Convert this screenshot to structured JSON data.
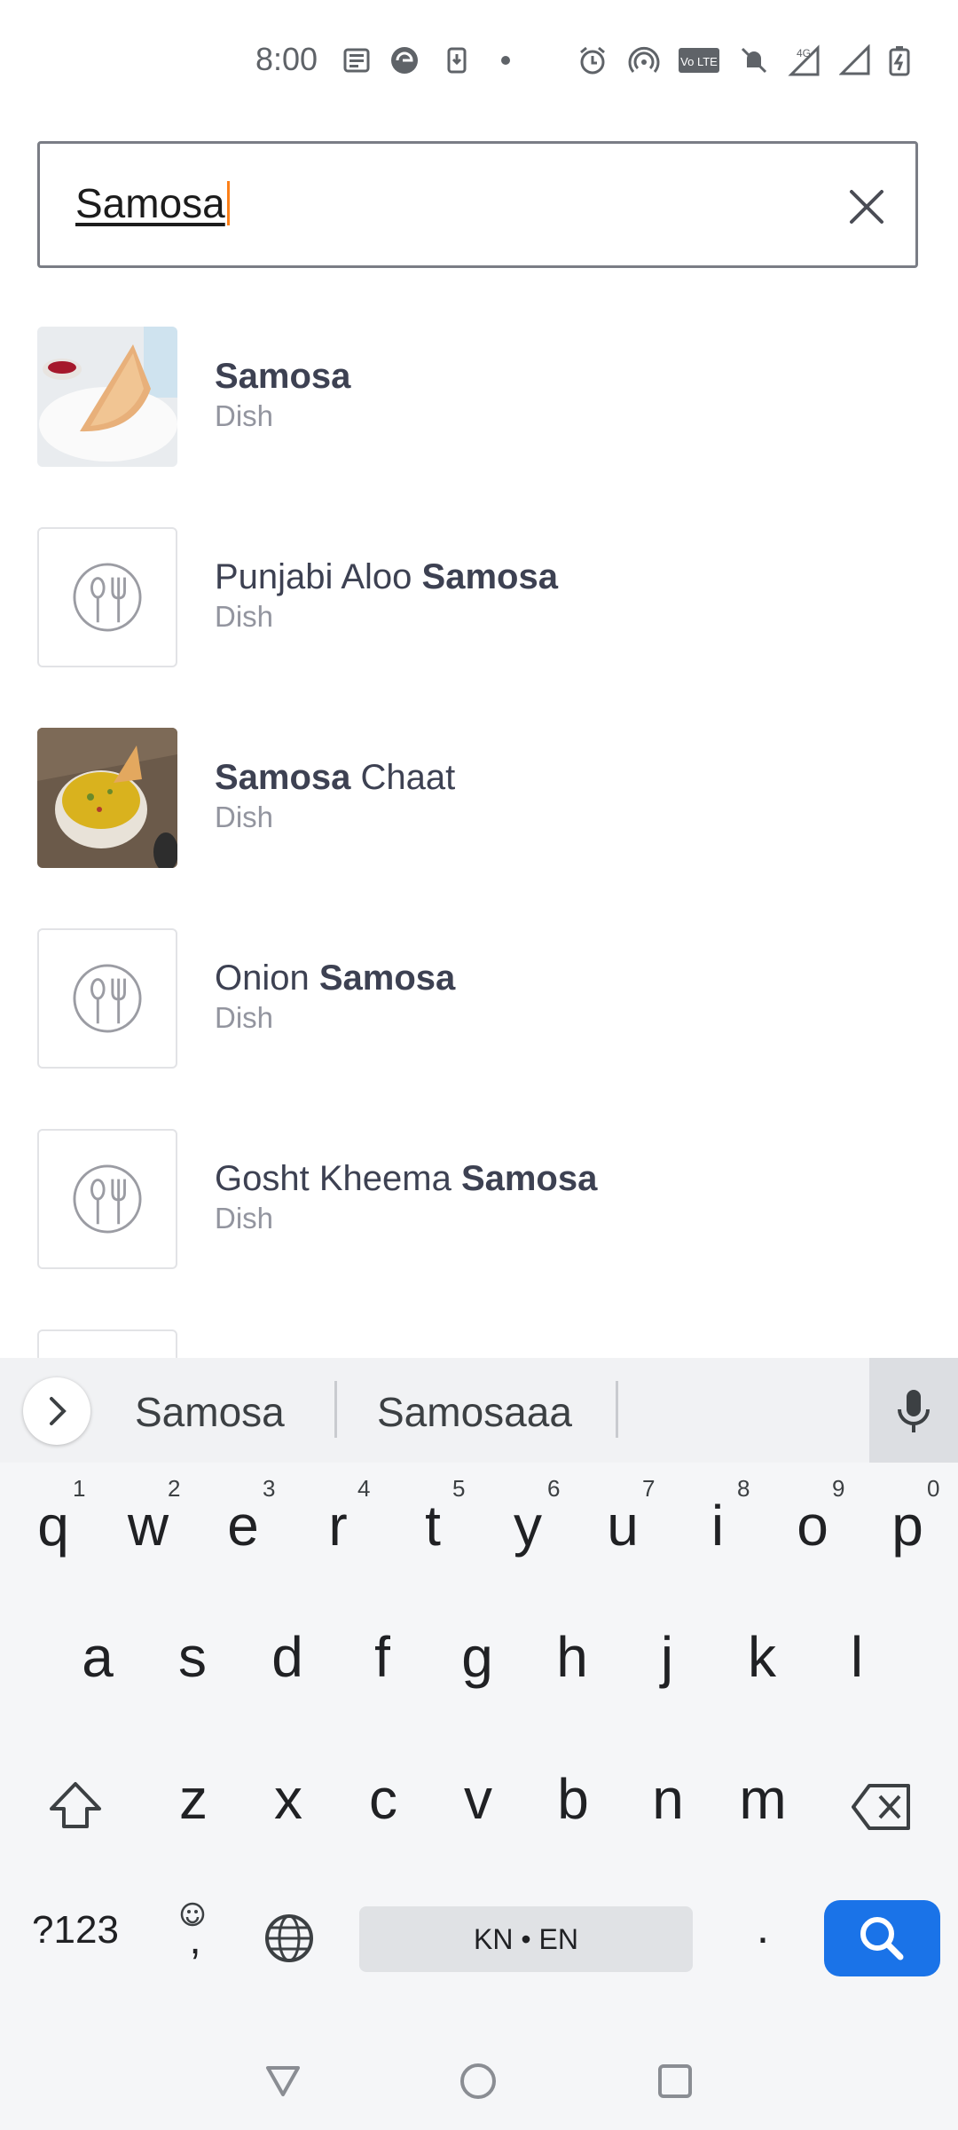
{
  "status_bar": {
    "time": "8:00"
  },
  "search": {
    "value": "Samosa"
  },
  "results": [
    {
      "prefix": "",
      "highlight": "Samosa",
      "suffix": "",
      "type": "Dish",
      "thumb": "photo-samosa"
    },
    {
      "prefix": "Punjabi Aloo ",
      "highlight": "Samosa",
      "suffix": "",
      "type": "Dish",
      "thumb": "dish-icon"
    },
    {
      "prefix": "",
      "highlight": "Samosa",
      "suffix": " Chaat",
      "type": "Dish",
      "thumb": "photo-samosa-chaat"
    },
    {
      "prefix": "Onion ",
      "highlight": "Samosa",
      "suffix": "",
      "type": "Dish",
      "thumb": "dish-icon"
    },
    {
      "prefix": "Gosht Kheema ",
      "highlight": "Samosa",
      "suffix": "",
      "type": "Dish",
      "thumb": "dish-icon"
    }
  ],
  "keyboard": {
    "suggestions": [
      "Samosa",
      "Samosaaa"
    ],
    "row1": [
      "q",
      "w",
      "e",
      "r",
      "t",
      "y",
      "u",
      "i",
      "o",
      "p"
    ],
    "row1_nums": [
      "1",
      "2",
      "3",
      "4",
      "5",
      "6",
      "7",
      "8",
      "9",
      "0"
    ],
    "row2": [
      "a",
      "s",
      "d",
      "f",
      "g",
      "h",
      "j",
      "k",
      "l"
    ],
    "row3": [
      "z",
      "x",
      "c",
      "v",
      "b",
      "n",
      "m"
    ],
    "symbols_label": "?123",
    "comma_label": ",",
    "space_label": "KN • EN",
    "period_label": "."
  },
  "icons": {
    "clear": "close-icon",
    "dish_placeholder": "fork-spoon-plate-icon",
    "mic": "microphone-icon",
    "search_action": "search-icon"
  },
  "colors": {
    "accent": "#fc8019",
    "keyboard_action": "#1a73e8",
    "text_primary": "#3d4152",
    "text_secondary": "#93959f"
  }
}
